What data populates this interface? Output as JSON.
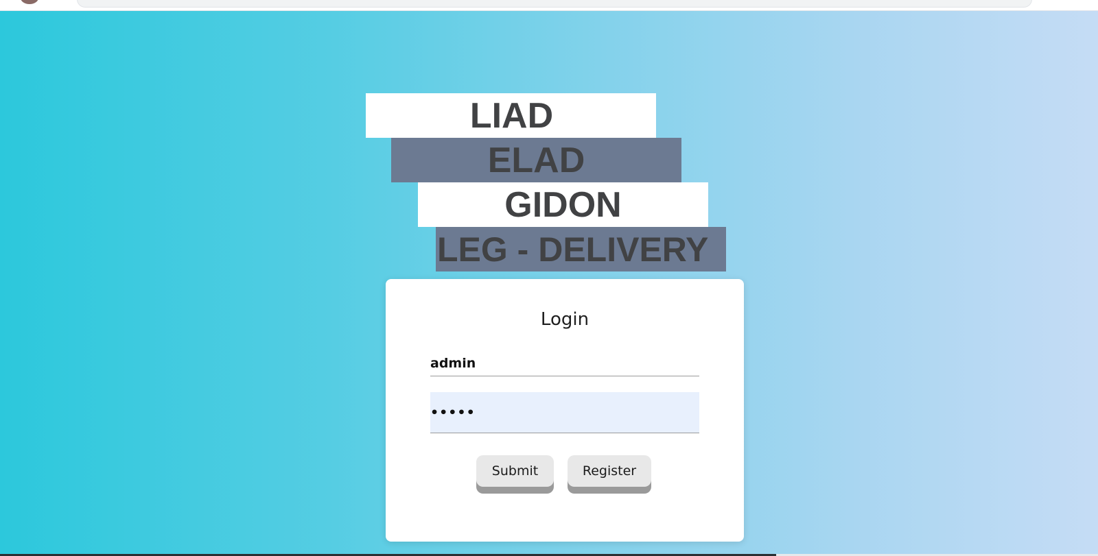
{
  "banners": {
    "line1": "LIAD",
    "line2": "ELAD",
    "line3": "GIDON",
    "line4": "LEG - DELIVERY"
  },
  "login": {
    "title": "Login",
    "username_value": "admin",
    "password_value": "•••••",
    "submit_label": "Submit",
    "register_label": "Register"
  },
  "colors": {
    "gradient_start": "#2cc8dc",
    "gradient_end": "#c5dcf5",
    "banner_light": "#ffffff",
    "banner_dark": "#6c7a92",
    "banner_text": "#414244",
    "autofill_bg": "#e8f0fd"
  }
}
